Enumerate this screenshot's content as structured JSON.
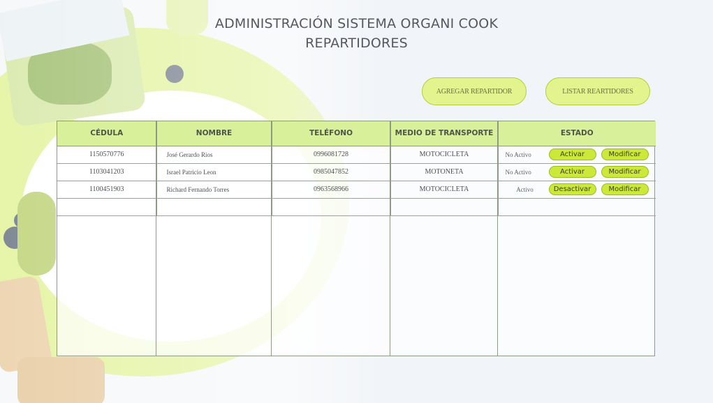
{
  "header": {
    "title_line1": "ADMINISTRACIÓN SISTEMA ORGANI COOK",
    "title_line2": "REPARTIDORES"
  },
  "actions": {
    "add_label": "AGREGAR REPARTIDOR",
    "list_label": "LISTAR REARTIDORES"
  },
  "table": {
    "headers": [
      "CÉDULA",
      "NOMBRE",
      "TELÉFONO",
      "MEDIO DE TRANSPORTE",
      "ESTADO"
    ],
    "rows": [
      {
        "cedula": "1150570776",
        "nombre": "José Gerardo Rios",
        "telefono": "0996081728",
        "transporte": "MOTOCICLETA",
        "estado": "No Activo",
        "toggle_label": "Activar",
        "modify_label": "Modificar"
      },
      {
        "cedula": "1103041203",
        "nombre": "Israel Patricio Leon",
        "telefono": "0985047852",
        "transporte": "MOTONETA",
        "estado": "No Activo",
        "toggle_label": "Activar",
        "modify_label": "Modificar"
      },
      {
        "cedula": "1100451903",
        "nombre": "Richard Fernando Torres",
        "telefono": "0963568966",
        "transporte": "MOTOCICLETA",
        "estado": "Activo",
        "toggle_label": "Desactivar",
        "modify_label": "Modificar"
      }
    ]
  },
  "colors": {
    "accent_button": "#cce83a",
    "header_fill": "#d8f09a",
    "pill_fill": "#e3f48f"
  }
}
